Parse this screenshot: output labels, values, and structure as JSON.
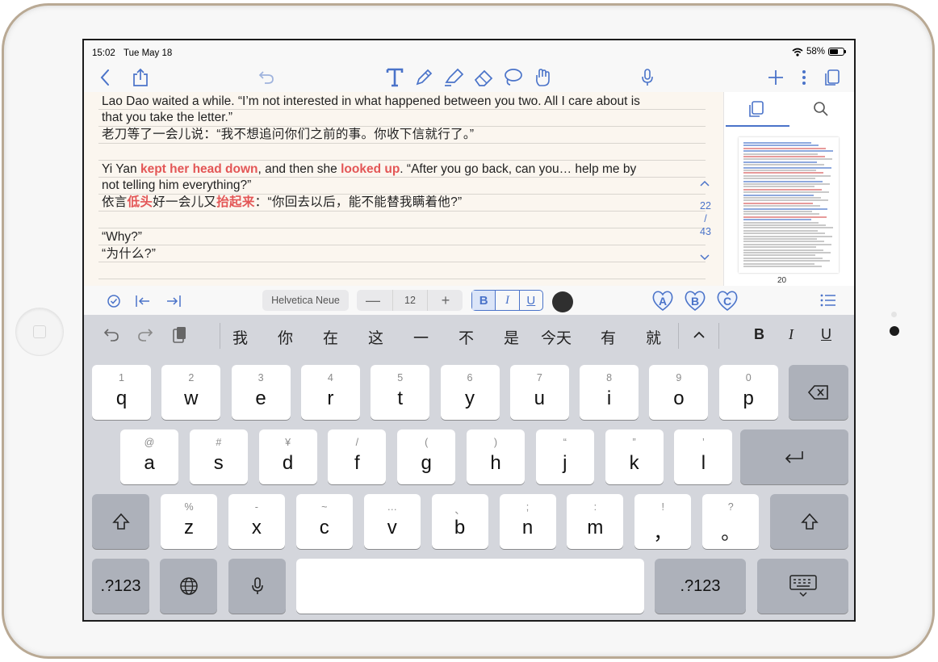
{
  "status": {
    "time": "15:02",
    "date": "Tue May 18",
    "battery": "58%"
  },
  "note": {
    "lines": [
      {
        "en1": "Lao Dao waited a while. “I’m not interested in what happened between you two. All I care about is",
        "en2": "that you take the letter.”",
        "cn": "老刀等了一会儿说：“我不想追问你们之前的事。你收下信就行了。”"
      },
      {
        "en_a": "Yi Yan ",
        "en_h1": "kept her head down",
        "en_b": ", and then she ",
        "en_h2": "looked up",
        "en_c": ". “After you go back, can you… help me by",
        "en2": "not telling him everything?”",
        "cn_a": "依言",
        "cn_h1": "低头",
        "cn_b": "好一会儿又",
        "cn_h2": "抬起来",
        "cn_c": "：“你回去以后，能不能替我瞒着他?”"
      },
      {
        "en": "“Why?”",
        "cn": "“为什么?”"
      }
    ],
    "page_current": "22",
    "page_sep": "/",
    "page_total": "43"
  },
  "sidebar": {
    "thumb_page": "20"
  },
  "format": {
    "font": "Helvetica Neue",
    "size": "12",
    "bold": "B",
    "italic": "I",
    "underline": "U",
    "ink_color": "#2f2f2f",
    "stamps": [
      "A",
      "B",
      "C"
    ]
  },
  "suggestions": [
    "我",
    "你",
    "在",
    "这",
    "一",
    "不",
    "是",
    "今天",
    "有",
    "就"
  ],
  "suggest_format": {
    "bold": "B",
    "italic": "I",
    "underline": "U"
  },
  "keys": {
    "row1": [
      {
        "hint": "1",
        "main": "q"
      },
      {
        "hint": "2",
        "main": "w"
      },
      {
        "hint": "3",
        "main": "e"
      },
      {
        "hint": "4",
        "main": "r"
      },
      {
        "hint": "5",
        "main": "t"
      },
      {
        "hint": "6",
        "main": "y"
      },
      {
        "hint": "7",
        "main": "u"
      },
      {
        "hint": "8",
        "main": "i"
      },
      {
        "hint": "9",
        "main": "o"
      },
      {
        "hint": "0",
        "main": "p"
      }
    ],
    "row2": [
      {
        "hint": "@",
        "main": "a"
      },
      {
        "hint": "#",
        "main": "s"
      },
      {
        "hint": "¥",
        "main": "d"
      },
      {
        "hint": "/",
        "main": "f"
      },
      {
        "hint": "(",
        "main": "g"
      },
      {
        "hint": ")",
        "main": "h"
      },
      {
        "hint": "“",
        "main": "j"
      },
      {
        "hint": "”",
        "main": "k"
      },
      {
        "hint": "’",
        "main": "l"
      }
    ],
    "row3": [
      {
        "hint": "%",
        "main": "z"
      },
      {
        "hint": "-",
        "main": "x"
      },
      {
        "hint": "~",
        "main": "c"
      },
      {
        "hint": "…",
        "main": "v"
      },
      {
        "hint": "、",
        "main": "b"
      },
      {
        "hint": ";",
        "main": "n"
      },
      {
        "hint": ":",
        "main": "m"
      },
      {
        "hint": "!",
        "main": "，"
      },
      {
        "hint": "?",
        "main": "。"
      }
    ],
    "numbers_label": ".?123"
  },
  "colors": {
    "accent": "#4a73c9",
    "highlight": "#e35656",
    "note_bg": "#fbf6ef"
  }
}
